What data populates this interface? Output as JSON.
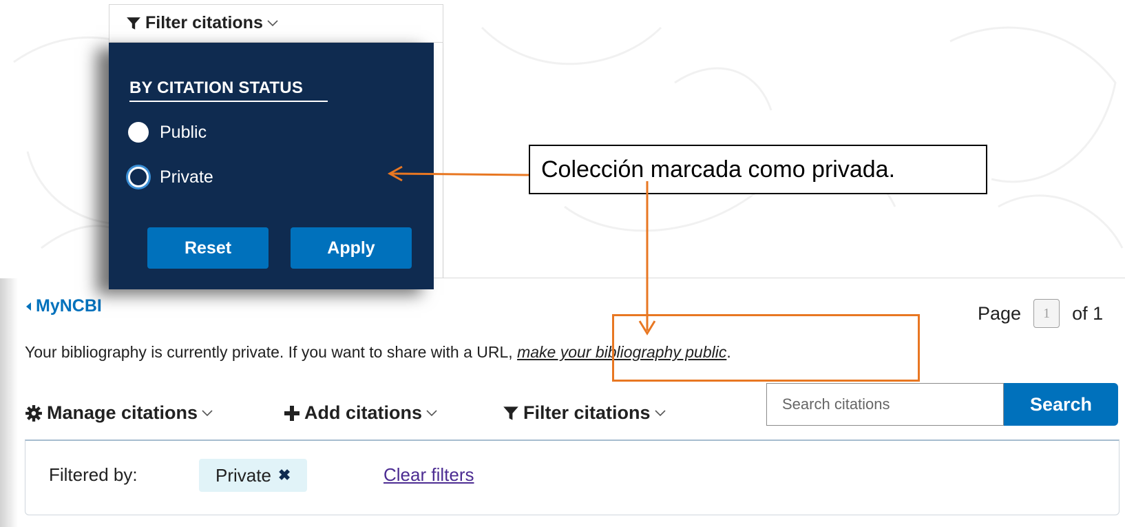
{
  "filter_dropdown": {
    "toggle_label": "Filter citations",
    "section_heading": "BY CITATION STATUS",
    "options": [
      {
        "label": "Public",
        "selected": false
      },
      {
        "label": "Private",
        "selected": true
      }
    ],
    "reset_label": "Reset",
    "apply_label": "Apply"
  },
  "annotation": {
    "callout_text": "Colección marcada como privada.",
    "arrow_color": "#e87722"
  },
  "header": {
    "back_link": "MyNCBI",
    "page_label": "Page",
    "page_number": "1",
    "page_of": "of 1"
  },
  "notice": {
    "text": "Your bibliography is currently private. If you want to share with a URL, ",
    "link_text": "make your bibliography public",
    "end": "."
  },
  "toolbar": {
    "manage_label": "Manage citations",
    "add_label": "Add citations",
    "filter_label": "Filter citations"
  },
  "search": {
    "placeholder": "Search citations",
    "button_label": "Search"
  },
  "filters": {
    "filtered_by_label": "Filtered by:",
    "active_filter": "Private",
    "clear_label": "Clear filters"
  },
  "colors": {
    "panel_background": "#0f2b50",
    "primary_button": "#0071bc",
    "chip_background": "#e1f3f8",
    "highlight": "#e87722"
  }
}
